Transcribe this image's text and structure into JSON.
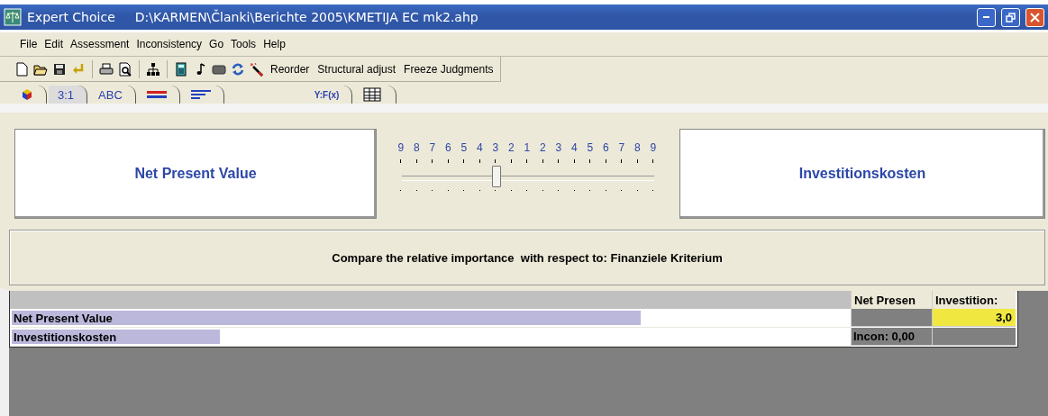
{
  "window": {
    "title": "Expert Choice",
    "path": "D:\\KARMEN\\Članki\\Berichte 2005\\KMETIJA EC mk2.ahp"
  },
  "menu": [
    "File",
    "Edit",
    "Assessment",
    "Inconsistency",
    "Go",
    "Tools",
    "Help"
  ],
  "toolbar": {
    "buttons": [
      "Reorder",
      "Structural adjust",
      "Freeze Judgments"
    ]
  },
  "tabs": [
    {
      "kind": "icon",
      "selected": false
    },
    {
      "kind": "text",
      "label": "3:1",
      "selected": true
    },
    {
      "kind": "text",
      "label": "ABC",
      "selected": false
    },
    {
      "kind": "icon",
      "selected": false
    },
    {
      "kind": "icon",
      "selected": false
    },
    {
      "kind": "text",
      "label": "Y:F(x)",
      "selected": false
    },
    {
      "kind": "icon",
      "selected": false
    }
  ],
  "comparison": {
    "left": "Net Present Value",
    "right": "Investitionskosten",
    "scale": [
      "9",
      "8",
      "7",
      "6",
      "5",
      "4",
      "3",
      "2",
      "1",
      "2",
      "3",
      "4",
      "5",
      "6",
      "7",
      "8",
      "9"
    ],
    "slider": {
      "level": 0.375
    },
    "prompt": "Compare the relative importance  with respect to: Finanziele Kriterium"
  },
  "matrix": {
    "columns": [
      "Net Presen",
      "Investition:"
    ],
    "rows": [
      {
        "name": "Net Present Value",
        "level": 0.75,
        "cells": [
          {
            "kind": "diagonal"
          },
          {
            "kind": "judgment",
            "value": "3,0"
          }
        ]
      },
      {
        "name": "Investitionskosten",
        "level": 0.25,
        "cells": [
          {
            "kind": "incon",
            "value": "Incon: 0,00"
          },
          {
            "kind": "diagonal"
          }
        ]
      }
    ]
  }
}
